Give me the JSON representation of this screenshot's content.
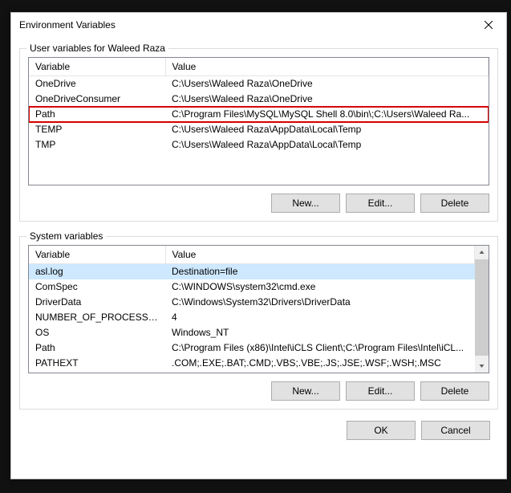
{
  "window": {
    "title": "Environment Variables"
  },
  "user_section": {
    "label": "User variables for Waleed Raza",
    "col_variable": "Variable",
    "col_value": "Value",
    "rows": [
      {
        "variable": "OneDrive",
        "value": "C:\\Users\\Waleed Raza\\OneDrive"
      },
      {
        "variable": "OneDriveConsumer",
        "value": "C:\\Users\\Waleed Raza\\OneDrive"
      },
      {
        "variable": "Path",
        "value": "C:\\Program Files\\MySQL\\MySQL Shell 8.0\\bin\\;C:\\Users\\Waleed Ra..."
      },
      {
        "variable": "TEMP",
        "value": "C:\\Users\\Waleed Raza\\AppData\\Local\\Temp"
      },
      {
        "variable": "TMP",
        "value": "C:\\Users\\Waleed Raza\\AppData\\Local\\Temp"
      }
    ],
    "highlight_index": 2,
    "new_label": "New...",
    "edit_label": "Edit...",
    "delete_label": "Delete"
  },
  "system_section": {
    "label": "System variables",
    "col_variable": "Variable",
    "col_value": "Value",
    "rows": [
      {
        "variable": "asl.log",
        "value": "Destination=file"
      },
      {
        "variable": "ComSpec",
        "value": "C:\\WINDOWS\\system32\\cmd.exe"
      },
      {
        "variable": "DriverData",
        "value": "C:\\Windows\\System32\\Drivers\\DriverData"
      },
      {
        "variable": "NUMBER_OF_PROCESSORS",
        "value": "4"
      },
      {
        "variable": "OS",
        "value": "Windows_NT"
      },
      {
        "variable": "Path",
        "value": "C:\\Program Files (x86)\\Intel\\iCLS Client\\;C:\\Program Files\\Intel\\iCL..."
      },
      {
        "variable": "PATHEXT",
        "value": ".COM;.EXE;.BAT;.CMD;.VBS;.VBE;.JS;.JSE;.WSF;.WSH;.MSC"
      }
    ],
    "selected_index": 0,
    "new_label": "New...",
    "edit_label": "Edit...",
    "delete_label": "Delete"
  },
  "footer": {
    "ok_label": "OK",
    "cancel_label": "Cancel"
  }
}
